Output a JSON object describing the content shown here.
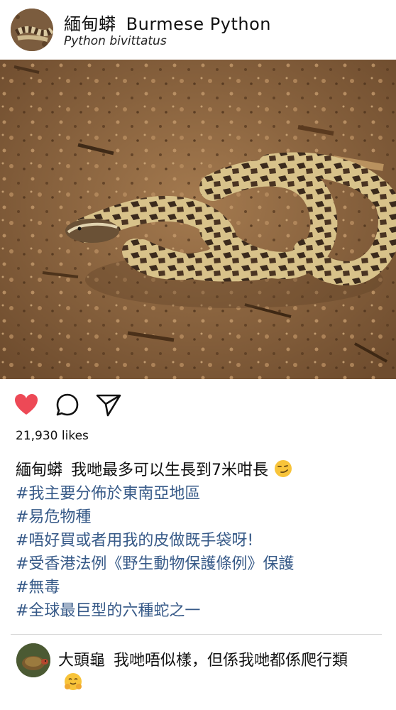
{
  "post": {
    "username": "緬甸蟒",
    "display_name": "Burmese Python",
    "scientific_name": "Python bivittatus",
    "avatar_icon": "snake-avatar",
    "likes": "21,930 likes"
  },
  "actions": {
    "like_icon": "heart-icon",
    "like_color": "#ed4956",
    "comment_icon": "comment-icon",
    "share_icon": "send-icon"
  },
  "caption": {
    "username": "緬甸蟒",
    "text": "我哋最多可以生長到7米咁長",
    "emoji": "smirk-emoji",
    "hashtags": [
      "#我主要分佈於東南亞地區",
      "#易危物種",
      "#唔好買或者用我的皮做既手袋呀!",
      "#受香港法例《野生動物保護條例》保護",
      "#無毒",
      "#全球最巨型的六種蛇之一"
    ],
    "hashtag_color": "#375a88"
  },
  "comments": [
    {
      "username": "大頭龜",
      "text": "我哋唔似樣，但係我哋都係爬行類",
      "emoji": "hugging-emoji",
      "avatar_icon": "turtle-avatar"
    }
  ]
}
